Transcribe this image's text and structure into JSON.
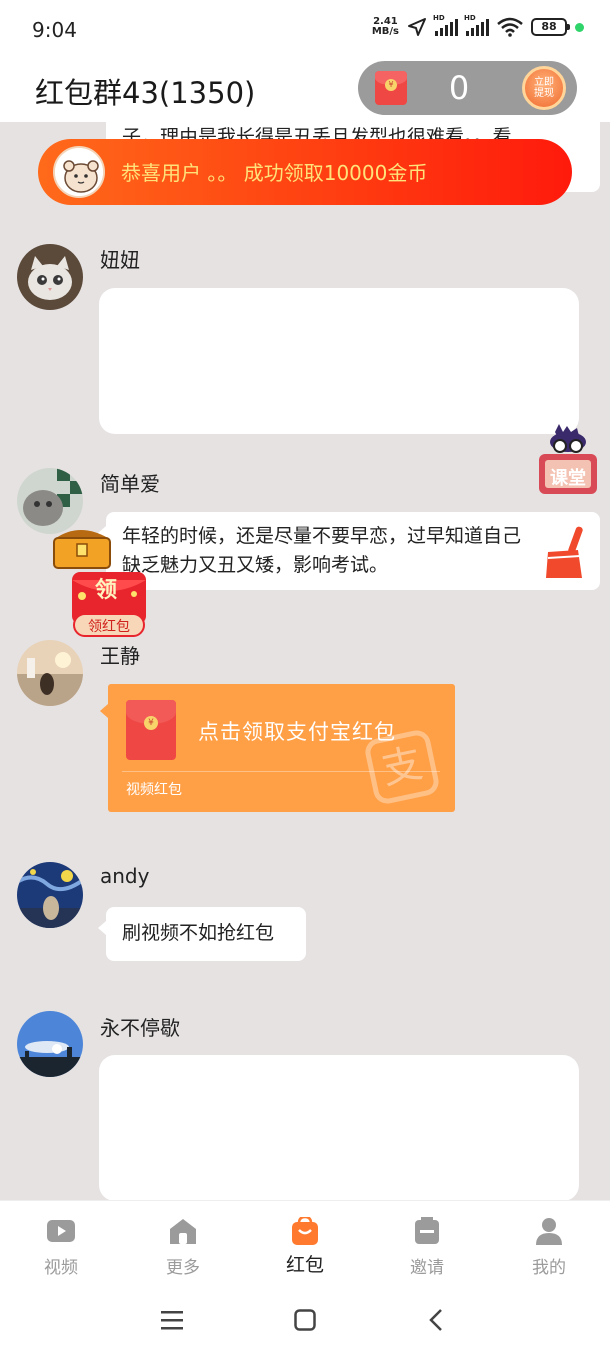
{
  "status_bar": {
    "time": "9:04",
    "net_speed_value": "2.41",
    "net_speed_unit": "MB/s",
    "hd_label": "HD",
    "battery": "88"
  },
  "header": {
    "title": "红包群43(1350)",
    "coin_count": "0",
    "withdraw_label_line1": "立即",
    "withdraw_label_line2": "提现"
  },
  "banner": {
    "text": "恭喜用户 。。 成功领取10000金币"
  },
  "partial_message": {
    "text": "子，理由是我长得是丑丢且发型也很难看。。看"
  },
  "messages": [
    {
      "user": "妞妞",
      "type": "blank"
    },
    {
      "user": "简单爱",
      "type": "text",
      "lines": [
        "年轻的时候，还是尽量不要早恋，过早知道自己",
        "缺乏魅力又丑又矮，影响考试。"
      ]
    },
    {
      "user": "王静",
      "type": "red_packet",
      "title": "点击领取支付宝红包",
      "subtitle": "视频红包"
    },
    {
      "user": "andy",
      "type": "text",
      "lines": [
        "刷视频不如抢红包"
      ]
    },
    {
      "user": "永不停歇",
      "type": "blank"
    }
  ],
  "floating": {
    "class_label": "课堂",
    "treasure_top_label": "领",
    "treasure_label": "领红包"
  },
  "bottom_nav": [
    {
      "label": "视频",
      "icon": "video-icon",
      "active": false
    },
    {
      "label": "更多",
      "icon": "home-icon",
      "active": false
    },
    {
      "label": "红包",
      "icon": "red-packet-bag-icon",
      "active": true
    },
    {
      "label": "邀请",
      "icon": "invite-box-icon",
      "active": false
    },
    {
      "label": "我的",
      "icon": "user-icon",
      "active": false
    }
  ],
  "colors": {
    "accent": "#ff7a2f",
    "chat_bg": "#e6e2e2",
    "banner_text": "#ffe27a",
    "red_packet_card": "#ff9f46"
  }
}
